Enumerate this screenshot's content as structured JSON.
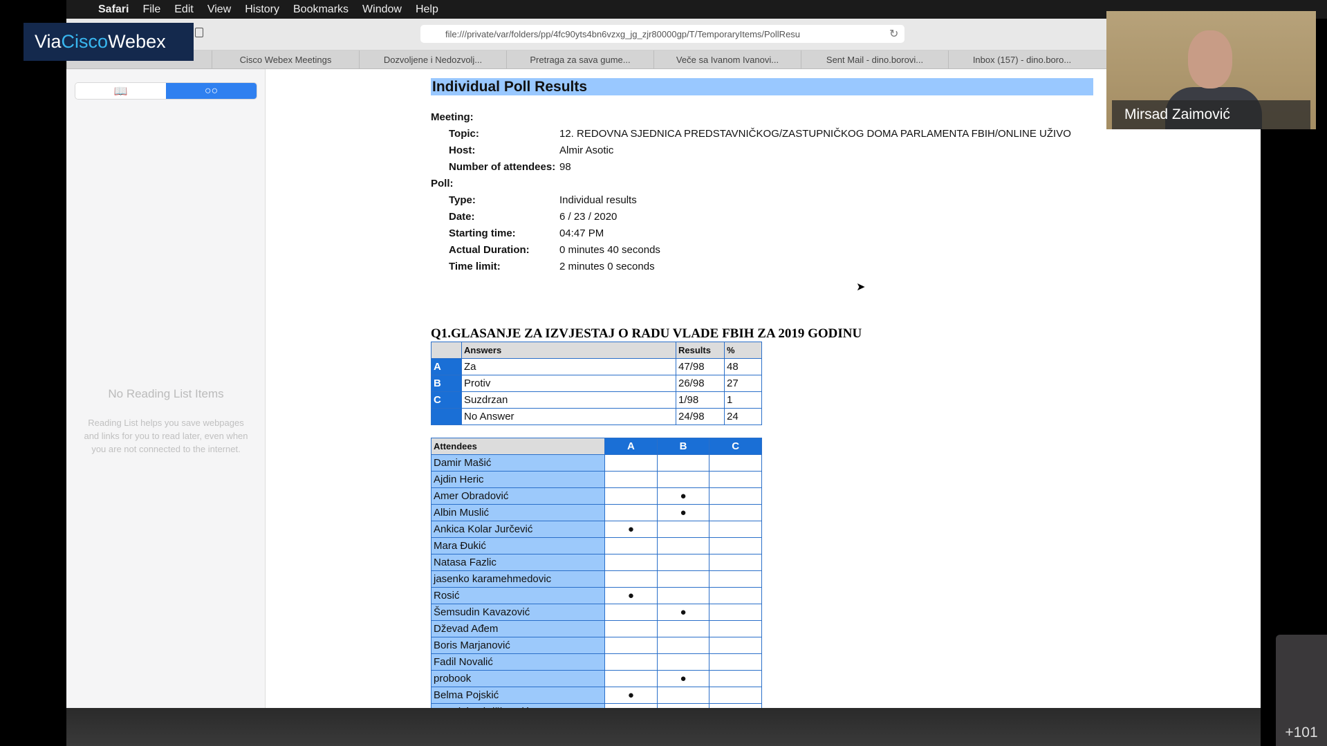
{
  "menubar": {
    "app": "Safari",
    "items": [
      "File",
      "Edit",
      "View",
      "History",
      "Bookmarks",
      "Window",
      "Help"
    ]
  },
  "browser": {
    "url": "file:///private/var/folders/pp/4fc90yts4bn6vzxg_jg_zjr80000gp/T/TemporaryItems/PollResu",
    "tabs": [
      "",
      "Cisco Webex Meetings",
      "Dozvoljene i Nedozvolj...",
      "Pretraga za sava gume...",
      "Veče sa Ivanom Ivanovi...",
      "Sent Mail - dino.borovi...",
      "Inbox (157) - dino.boro..."
    ]
  },
  "sidebar": {
    "empty_title": "No Reading List Items",
    "empty_desc": "Reading List helps you save webpages and links for you to read later, even when you are not connected to the internet.",
    "active_tab": "reading-list"
  },
  "page": {
    "title": "Individual Poll Results",
    "meeting_label": "Meeting:",
    "meeting": [
      {
        "k": "Topic:",
        "v": "12. REDOVNA SJEDNICA PREDSTAVNIČKOG/ZASTUPNIČKOG DOMA PARLAMENTA FBIH/ONLINE UŽIVO"
      },
      {
        "k": "Host:",
        "v": "Almir Asotic"
      },
      {
        "k": "Number of attendees:",
        "v": "98"
      }
    ],
    "poll_label": "Poll:",
    "poll": [
      {
        "k": "Type:",
        "v": "Individual results"
      },
      {
        "k": "Date:",
        "v": "6 / 23 / 2020"
      },
      {
        "k": "Starting time:",
        "v": "04:47 PM"
      },
      {
        "k": "Actual Duration:",
        "v": "0 minutes 40 seconds"
      },
      {
        "k": "Time limit:",
        "v": "2 minutes 0 seconds"
      }
    ],
    "question": "Q1.GLASANJE ZA IZVJESTAJ O RADU VLADE FBIH ZA 2019 GODINU",
    "answers_headers": [
      "Answers",
      "Results",
      "%"
    ],
    "answers": [
      {
        "letter": "A",
        "answer": "Za",
        "result": "47/98",
        "pct": "48"
      },
      {
        "letter": "B",
        "answer": "Protiv",
        "result": "26/98",
        "pct": "27"
      },
      {
        "letter": "C",
        "answer": "Suzdrzan",
        "result": "1/98",
        "pct": "1"
      },
      {
        "letter": "",
        "answer": "No Answer",
        "result": "24/98",
        "pct": "24"
      }
    ],
    "attendees_header": "Attendees",
    "columns": [
      "A",
      "B",
      "C"
    ],
    "attendees": [
      {
        "name": "Damir Mašić",
        "vote": ""
      },
      {
        "name": "Ajdin Heric",
        "vote": ""
      },
      {
        "name": "Amer Obradović",
        "vote": "B"
      },
      {
        "name": "Albin Muslić",
        "vote": "B"
      },
      {
        "name": "Ankica Kolar Jurčević",
        "vote": "A"
      },
      {
        "name": "Mara Đukić",
        "vote": ""
      },
      {
        "name": "Natasa Fazlic",
        "vote": ""
      },
      {
        "name": "jasenko karamehmedovic",
        "vote": ""
      },
      {
        "name": "Rosić",
        "vote": "A"
      },
      {
        "name": "Šemsudin Kavazović",
        "vote": "B"
      },
      {
        "name": "Dževad Ađem",
        "vote": ""
      },
      {
        "name": "Boris Marjanović",
        "vote": ""
      },
      {
        "name": "Fadil Novalić",
        "vote": ""
      },
      {
        "name": "probook",
        "vote": "B"
      },
      {
        "name": "Belma Pojskić",
        "vote": "A"
      },
      {
        "name": "Jasminka Ibrišimović",
        "vote": ""
      }
    ],
    "vote_mark": "●"
  },
  "webex": {
    "via": "Via ",
    "cisco": "Cisco",
    "webex": "Webex"
  },
  "video": {
    "speaker": "Mirsad Zaimović",
    "more_participants": "+101"
  }
}
